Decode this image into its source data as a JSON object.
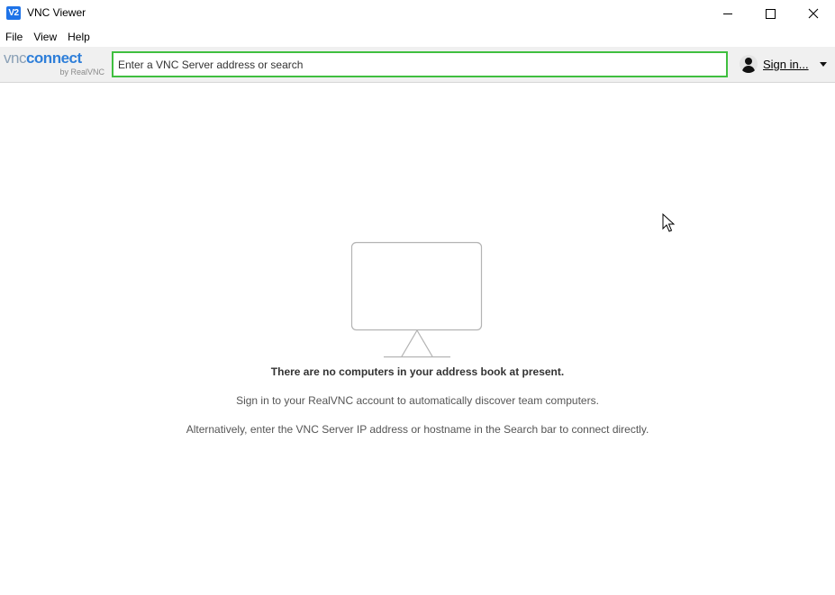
{
  "window": {
    "title": "VNC Viewer",
    "app_icon_text": "V2",
    "controls": [
      "minimize-icon",
      "maximize-icon",
      "close-icon"
    ]
  },
  "menu": {
    "items": [
      "File",
      "View",
      "Help"
    ]
  },
  "toolbar": {
    "logo": {
      "vnc": "vnc",
      "connect": "connect",
      "sub": "by RealVNC"
    },
    "search": {
      "placeholder": "Enter a VNC Server address or search",
      "value": ""
    },
    "signin_label": "Sign in...",
    "accent_color": "#3fbf3f"
  },
  "main": {
    "empty_title": "There are no computers in your address book at present.",
    "empty_line1": "Sign in to your RealVNC account to automatically discover team computers.",
    "empty_line2": "Alternatively, enter the VNC Server IP address or hostname in the Search bar to connect directly."
  }
}
